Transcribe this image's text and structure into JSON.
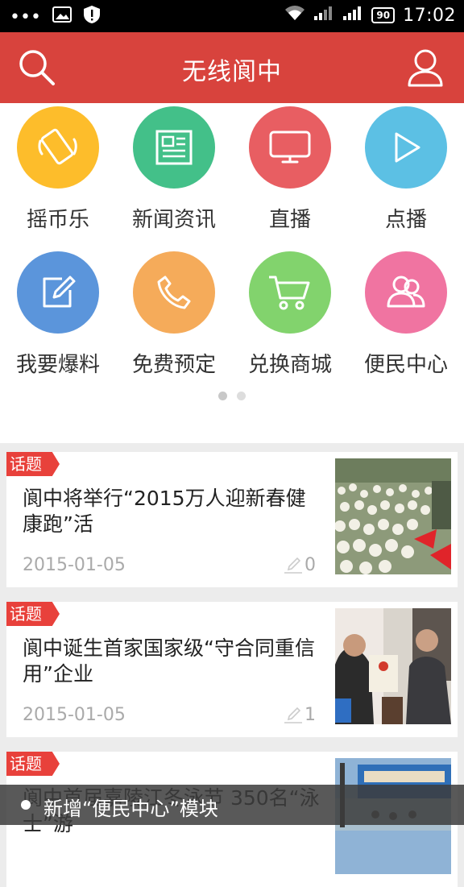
{
  "status_bar": {
    "time": "17:02",
    "battery": "90"
  },
  "header": {
    "title": "无线阆中",
    "search_icon": "search-icon",
    "user_icon": "user-icon",
    "color": "#d8433d"
  },
  "grid": {
    "items": [
      {
        "label": "摇币乐",
        "icon": "shake-phone-icon",
        "color": "#fdbd2b"
      },
      {
        "label": "新闻资讯",
        "icon": "newspaper-icon",
        "color": "#43c089"
      },
      {
        "label": "直播",
        "icon": "tv-icon",
        "color": "#e85e62"
      },
      {
        "label": "点播",
        "icon": "play-icon",
        "color": "#5cc0e4"
      },
      {
        "label": "我要爆料",
        "icon": "edit-icon",
        "color": "#5b95db"
      },
      {
        "label": "免费预定",
        "icon": "phone-icon",
        "color": "#f5ab5a"
      },
      {
        "label": "兑换商城",
        "icon": "cart-icon",
        "color": "#82d36d"
      },
      {
        "label": "便民中心",
        "icon": "people-icon",
        "color": "#f074a1"
      }
    ],
    "page_indicator": {
      "pages": 2,
      "current": 1
    }
  },
  "news": [
    {
      "tag": "话题",
      "title": "阆中将举行“2015万人迎新春健康跑”活",
      "date": "2015-01-05",
      "comments": "0"
    },
    {
      "tag": "话题",
      "title": "阆中诞生首家国家级“守合同重信用”企业",
      "date": "2015-01-05",
      "comments": "1"
    },
    {
      "tag": "话题",
      "title": "阆中首届嘉陵江冬泳节 350名“泳士”游",
      "date": "",
      "comments": ""
    }
  ],
  "notice": {
    "text": "新增“便民中心”模块"
  }
}
